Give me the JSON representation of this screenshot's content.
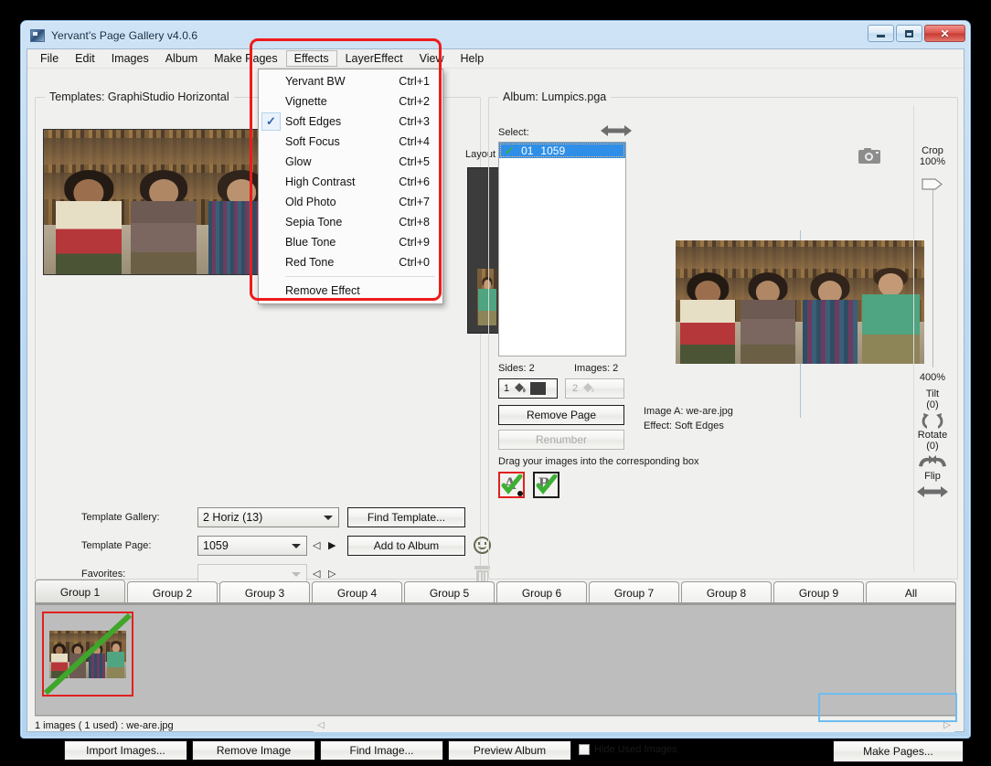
{
  "window": {
    "title": "Yervant's Page Gallery v4.0.6",
    "icon": "app-icon",
    "caption_buttons": [
      {
        "name": "minimize",
        "glyph": "minimize-icon"
      },
      {
        "name": "maximize",
        "glyph": "maximize-icon"
      },
      {
        "name": "close",
        "glyph": "✕"
      }
    ]
  },
  "menubar": {
    "items": [
      {
        "label": "File",
        "open": false
      },
      {
        "label": "Edit",
        "open": false
      },
      {
        "label": "Images",
        "open": false
      },
      {
        "label": "Album",
        "open": false
      },
      {
        "label": "Make Pages",
        "open": false
      },
      {
        "label": "Effects",
        "open": true
      },
      {
        "label": "LayerEffect",
        "open": false
      },
      {
        "label": "View",
        "open": false
      },
      {
        "label": "Help",
        "open": false
      }
    ]
  },
  "effects_menu": {
    "items": [
      {
        "label": "Yervant BW",
        "shortcut": "Ctrl+1",
        "checked": false
      },
      {
        "label": "Vignette",
        "shortcut": "Ctrl+2",
        "checked": false
      },
      {
        "label": "Soft Edges",
        "shortcut": "Ctrl+3",
        "checked": true
      },
      {
        "label": "Soft Focus",
        "shortcut": "Ctrl+4",
        "checked": false
      },
      {
        "label": "Glow",
        "shortcut": "Ctrl+5",
        "checked": false
      },
      {
        "label": "High Contrast",
        "shortcut": "Ctrl+6",
        "checked": false
      },
      {
        "label": "Old Photo",
        "shortcut": "Ctrl+7",
        "checked": false
      },
      {
        "label": "Sepia Tone",
        "shortcut": "Ctrl+8",
        "checked": false
      },
      {
        "label": "Blue Tone",
        "shortcut": "Ctrl+9",
        "checked": false
      },
      {
        "label": "Red Tone",
        "shortcut": "Ctrl+0",
        "checked": false
      }
    ],
    "remove_label": "Remove Effect",
    "check_glyph": "✓"
  },
  "templates_panel": {
    "group_label": "Templates:  GraphiStudio Horizontal",
    "layout_label": "Layout",
    "template_gallery_label": "Template Gallery:",
    "template_gallery_value": "2 Horiz (13)",
    "template_page_label": "Template Page:",
    "template_page_value": "1059",
    "favorites_label": "Favorites:",
    "favorites_value": "",
    "find_template_label": "Find Template...",
    "add_to_album_label": "Add to Album",
    "smiley_icon": "smiley-icon",
    "trash_icon": "trash-icon",
    "prev_glyph": "◁",
    "next_glyph": "▶",
    "next_glyph_hollow": "▷"
  },
  "album_panel": {
    "group_label": "Album:  Lumpics.pga",
    "select_label": "Select:",
    "swap_icon": "left-right-arrow-icon",
    "camera_icon": "camera-icon",
    "list": [
      {
        "index": "01",
        "page": "1059",
        "checked": true,
        "selected": true
      }
    ],
    "sides_label": "Sides: 2",
    "images_label": "Images: 2",
    "side1_number": "1",
    "side2_number": "2",
    "side1_icon": "paint-bucket-icon",
    "side2_icon": "paint-bucket-icon",
    "side1_swatch_color": "#3b3b3b",
    "remove_page_label": "Remove Page",
    "renumber_label": "Renumber",
    "image_a_label": "Image A: we-are.jpg",
    "effect_label": "Effect: Soft Edges",
    "drag_hint": "Drag your images into the corresponding box",
    "drop_boxes": [
      {
        "letter": "A",
        "checked": true,
        "selected": true
      },
      {
        "letter": "B",
        "checked": true,
        "selected": false
      }
    ]
  },
  "crop_panel": {
    "crop_label": "Crop",
    "crop_value": "100%",
    "crop_max": "400%",
    "tilt_label": "Tilt",
    "tilt_value": "(0)",
    "rotate_label": "Rotate",
    "rotate_value": "(0)",
    "flip_label": "Flip",
    "tilt_icon": "tilt-arrows-icon",
    "rotate_icon": "rotate-arrows-icon",
    "flip_icon": "flip-horizontal-icon",
    "slider_handle": "crop-slider-handle"
  },
  "tabs": [
    {
      "label": "Group 1",
      "active": true
    },
    {
      "label": "Group 2",
      "active": false
    },
    {
      "label": "Group 3",
      "active": false
    },
    {
      "label": "Group 4",
      "active": false
    },
    {
      "label": "Group 5",
      "active": false
    },
    {
      "label": "Group 6",
      "active": false
    },
    {
      "label": "Group 7",
      "active": false
    },
    {
      "label": "Group 8",
      "active": false
    },
    {
      "label": "Group 9",
      "active": false
    },
    {
      "label": "All",
      "active": false
    }
  ],
  "statusbar": {
    "text": "1 images ( 1 used) : we-are.jpg",
    "scroll_left_glyph": "◁",
    "scroll_right_glyph": "▷"
  },
  "bottombar": {
    "import_label": "Import Images...",
    "remove_label": "Remove Image",
    "find_label": "Find Image...",
    "preview_label": "Preview Album",
    "hide_used_label": "Hide Used Images",
    "hide_used_checked": false,
    "make_pages_label": "Make Pages..."
  },
  "highlights": {
    "accent_red": "#ee1b1b",
    "accent_blue": "#6fbdf0"
  }
}
